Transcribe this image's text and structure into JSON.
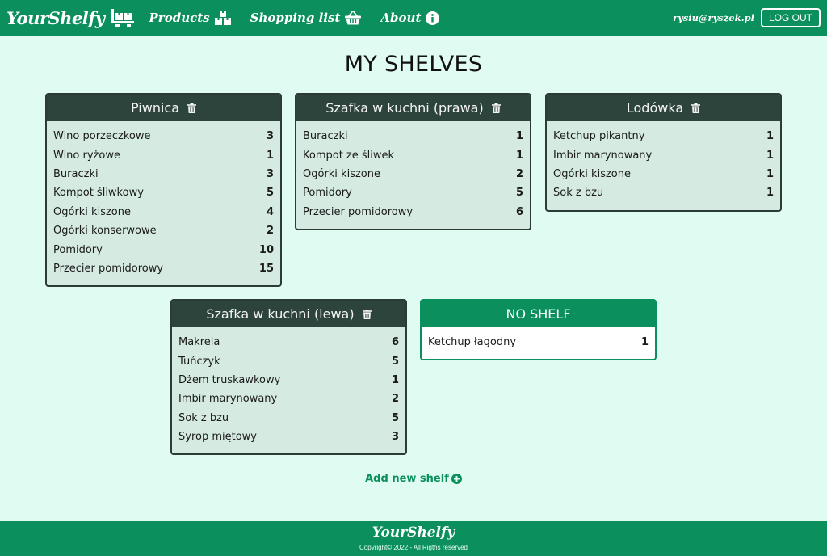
{
  "navbar": {
    "brand": "YourShelfy",
    "brand_icon": "pallet-boxes-icon",
    "links": [
      {
        "label": "Products",
        "icon": "boxes-icon"
      },
      {
        "label": "Shopping list",
        "icon": "basket-icon"
      },
      {
        "label": "About",
        "icon": "info-circle-icon"
      }
    ],
    "user_email": "rysiu@ryszek.pl",
    "logout_label": "LOG OUT"
  },
  "page_title": "MY SHELVES",
  "shelves": [
    {
      "name": "Piwnica",
      "items": [
        {
          "name": "Wino porzeczkowe",
          "qty": "3"
        },
        {
          "name": "Wino ryżowe",
          "qty": "1"
        },
        {
          "name": "Buraczki",
          "qty": "3"
        },
        {
          "name": "Kompot śliwkowy",
          "qty": "5"
        },
        {
          "name": "Ogórki kiszone",
          "qty": "4"
        },
        {
          "name": "Ogórki konserwowe",
          "qty": "2"
        },
        {
          "name": "Pomidory",
          "qty": "10"
        },
        {
          "name": "Przecier pomidorowy",
          "qty": "15"
        }
      ]
    },
    {
      "name": "Szafka w kuchni (prawa)",
      "items": [
        {
          "name": "Buraczki",
          "qty": "1"
        },
        {
          "name": "Kompot ze śliwek",
          "qty": "1"
        },
        {
          "name": "Ogórki kiszone",
          "qty": "2"
        },
        {
          "name": "Pomidory",
          "qty": "5"
        },
        {
          "name": "Przecier pomidorowy",
          "qty": "6"
        }
      ]
    },
    {
      "name": "Lodówka",
      "items": [
        {
          "name": "Ketchup pikantny",
          "qty": "1"
        },
        {
          "name": "Imbir marynowany",
          "qty": "1"
        },
        {
          "name": "Ogórki kiszone",
          "qty": "1"
        },
        {
          "name": "Sok z bzu",
          "qty": "1"
        }
      ]
    },
    {
      "name": "Szafka w kuchni (lewa)",
      "items": [
        {
          "name": "Makrela",
          "qty": "6"
        },
        {
          "name": "Tuńczyk",
          "qty": "5"
        },
        {
          "name": "Dżem truskawkowy",
          "qty": "1"
        },
        {
          "name": "Imbir marynowany",
          "qty": "2"
        },
        {
          "name": "Sok z bzu",
          "qty": "5"
        },
        {
          "name": "Syrop miętowy",
          "qty": "3"
        }
      ]
    }
  ],
  "no_shelf": {
    "name": "NO SHELF",
    "items": [
      {
        "name": "Ketchup łagodny",
        "qty": "1"
      }
    ]
  },
  "add_shelf_label": "Add new shelf",
  "footer": {
    "brand": "YourShelfy",
    "copyright": "Copyright© 2022 - All Rigths reserved"
  },
  "colors": {
    "primary": "#0b8f5c",
    "shelf_header": "#2c443c",
    "background": "#e0fbf1",
    "card": "#d5ebe2"
  }
}
